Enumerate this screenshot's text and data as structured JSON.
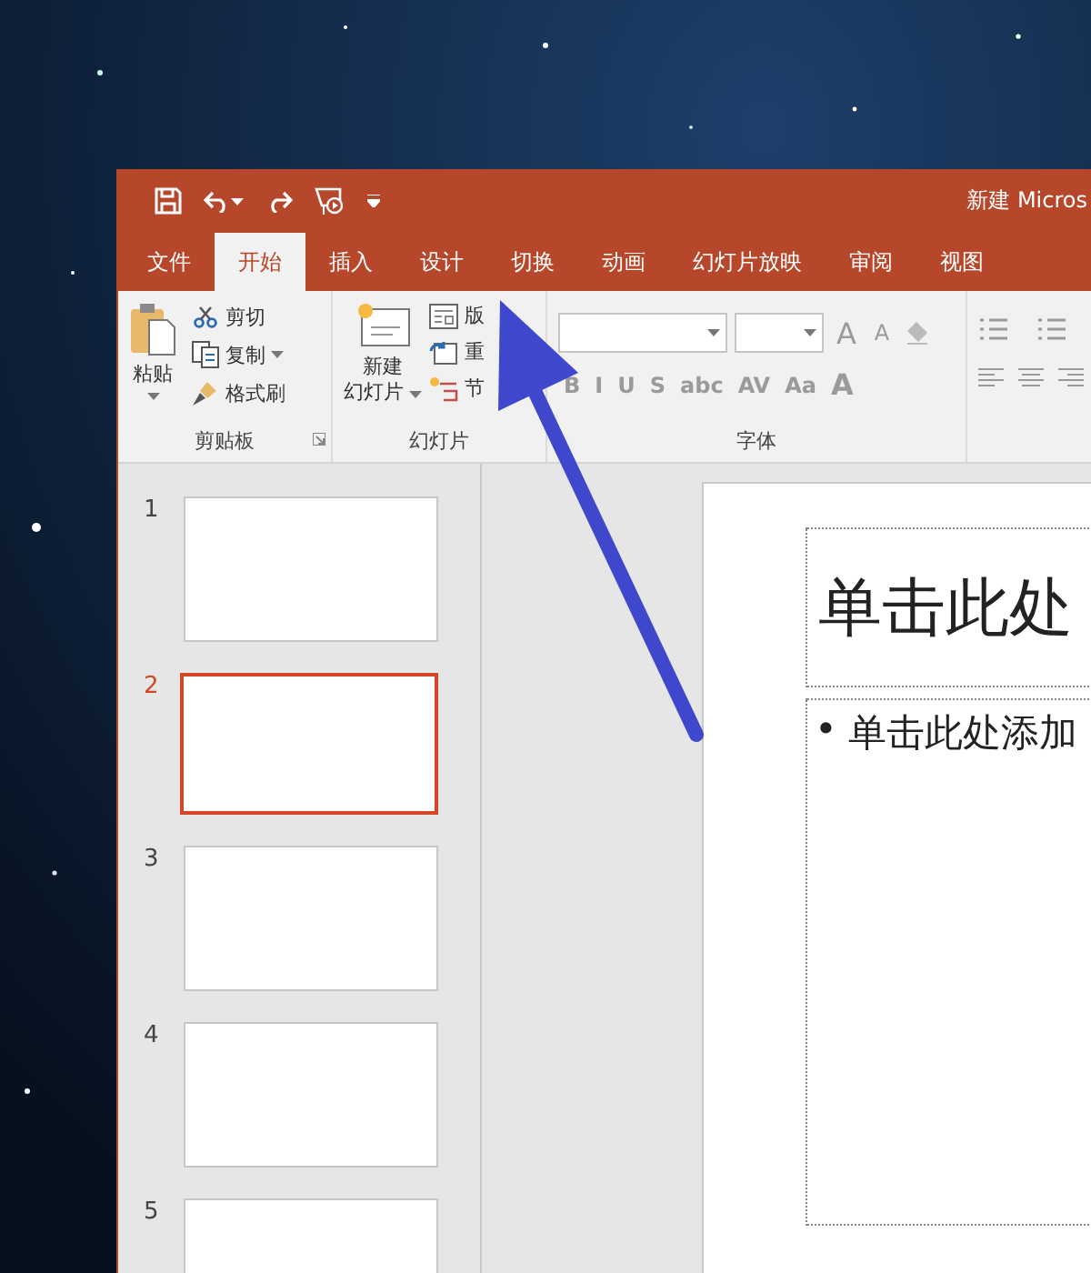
{
  "window": {
    "title": "新建 Micros"
  },
  "tabs": [
    {
      "label": "文件",
      "selected": false
    },
    {
      "label": "开始",
      "selected": true
    },
    {
      "label": "插入",
      "selected": false
    },
    {
      "label": "设计",
      "selected": false
    },
    {
      "label": "切换",
      "selected": false
    },
    {
      "label": "动画",
      "selected": false
    },
    {
      "label": "幻灯片放映",
      "selected": false
    },
    {
      "label": "审阅",
      "selected": false
    },
    {
      "label": "视图",
      "selected": false
    }
  ],
  "ribbon": {
    "clipboard": {
      "label": "剪贴板",
      "paste": "粘贴",
      "cut": "剪切",
      "copy": "复制",
      "format_painter": "格式刷"
    },
    "slides": {
      "label": "幻灯片",
      "new_slide": [
        "新建",
        "幻灯片"
      ],
      "layout": "版",
      "reset": "重",
      "section": "节"
    },
    "font": {
      "label": "字体",
      "grow": "A",
      "shrink": "A",
      "format_buttons": [
        "B",
        "I",
        "U",
        "S",
        "abc",
        "AV",
        "Aa"
      ],
      "font_color": "A"
    }
  },
  "thumbnails": [
    {
      "number": "1",
      "selected": false
    },
    {
      "number": "2",
      "selected": true
    },
    {
      "number": "3",
      "selected": false
    },
    {
      "number": "4",
      "selected": false
    },
    {
      "number": "5",
      "selected": false
    }
  ],
  "slide": {
    "title_placeholder": "单击此处",
    "bullet": "•",
    "body_placeholder": "单击此处添加"
  }
}
